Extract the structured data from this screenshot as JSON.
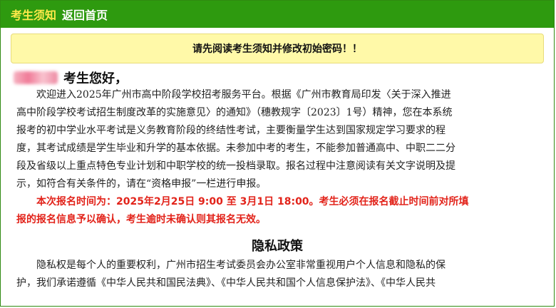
{
  "nav": {
    "notice_tab": "考生须知",
    "home_link": "返回首页"
  },
  "banner": {
    "text": "请先阅读考生须知并修改初始密码！！"
  },
  "greeting": {
    "suffix": "考生您好，"
  },
  "intro": {
    "lines": [
      "欢迎进入2025年广州市高中阶段学校招考服务平台。根据《广州市教育局印发〈关于深入推进",
      "高中阶段学校考试招生制度改革的实施意见〉的通知》（穗教规字〔2023〕1号）精神，您在本系统",
      "报考的初中学业水平考试是义务教育阶段的终结性考试，主要衡量学生达到国家规定学习要求的程",
      "度，其考试成绩是学生毕业和升学的基本依据。未参加中考的考生，不能参加普通高中、中职二二分",
      "段及省级以上重点特色专业计划和中职学校的统一投档录取。报名过程中注意阅读有关文字说明及提",
      "示，如符合有关条件的，请在“资格申报”一栏进行申报。"
    ]
  },
  "deadline": {
    "lines": [
      "本次报名时间为：2025年2月25日 9:00 至 3月1日 18:00。考生必须在报名截止时间前对所填",
      "报的报名信息予以确认，考生逾时未确认则其报名无效。"
    ]
  },
  "privacy": {
    "title": "隐私政策",
    "lines": [
      "隐私权是每个人的重要权利，广州市招生考试委员会办公室非常重视用户个人信息和隐私的保",
      "护，我们承诺遵循《中华人民共和国民法典》、《中华人民共和国个人信息保护法》、《中华人民共"
    ]
  }
}
